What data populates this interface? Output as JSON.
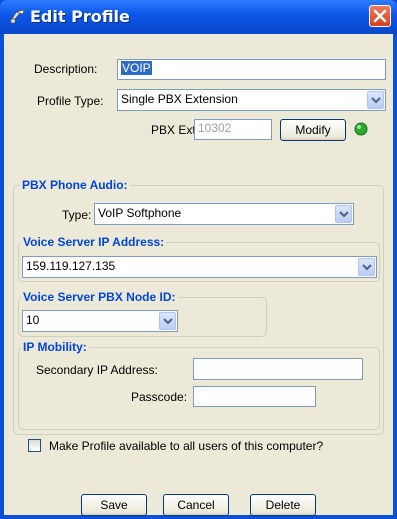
{
  "window": {
    "title": "Edit Profile"
  },
  "description": {
    "label": "Description:",
    "value": "VOIP"
  },
  "profile_type": {
    "label": "Profile Type:",
    "value": "Single PBX Extension"
  },
  "pbx_ext": {
    "label": "PBX Ext:",
    "value": "10302",
    "modify_label": "Modify",
    "status_color": "#2fa82f"
  },
  "pbx_phone_audio": {
    "title": "PBX Phone Audio:",
    "type_label": "Type:",
    "type_value": "VoIP Softphone",
    "voice_server_ip": {
      "title": "Voice Server IP Address:",
      "value": "159.119.127.135"
    },
    "voice_server_node": {
      "title": "Voice Server PBX Node ID:",
      "value": "10"
    },
    "ip_mobility": {
      "title": "IP Mobility:",
      "secondary_ip_label": "Secondary IP Address:",
      "secondary_ip_value": "",
      "passcode_label": "Passcode:",
      "passcode_value": ""
    }
  },
  "make_available": {
    "label": "Make Profile available to all users of this computer?",
    "checked": false
  },
  "buttons": {
    "save": "Save",
    "cancel": "Cancel",
    "delete": "Delete"
  },
  "colors": {
    "title_bar": "#0a56e6",
    "group_title": "#0046d5",
    "dialog_bg": "#ece9d8"
  }
}
